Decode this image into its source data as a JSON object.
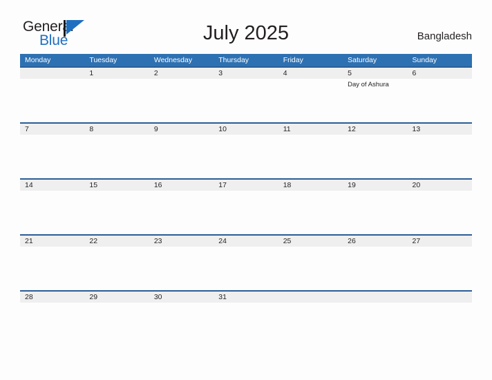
{
  "brand": {
    "name_part1": "General",
    "name_part2": "Blue",
    "flag_icon": "blue-flag-triangle-icon"
  },
  "header": {
    "title": "July 2025",
    "country": "Bangladesh"
  },
  "colors": {
    "header_blue": "#2e71b2",
    "row_rule_blue": "#2a5d96",
    "band_gray": "#efefef",
    "brand_blue": "#1f6fc0",
    "text": "#231f20",
    "page_background": "#fdfdfd"
  },
  "calendar": {
    "weekdays": [
      "Monday",
      "Tuesday",
      "Wednesday",
      "Thursday",
      "Friday",
      "Saturday",
      "Sunday"
    ],
    "weeks": [
      [
        {
          "date": "",
          "event": ""
        },
        {
          "date": "1",
          "event": ""
        },
        {
          "date": "2",
          "event": ""
        },
        {
          "date": "3",
          "event": ""
        },
        {
          "date": "4",
          "event": ""
        },
        {
          "date": "5",
          "event": "Day of Ashura"
        },
        {
          "date": "6",
          "event": ""
        }
      ],
      [
        {
          "date": "7",
          "event": ""
        },
        {
          "date": "8",
          "event": ""
        },
        {
          "date": "9",
          "event": ""
        },
        {
          "date": "10",
          "event": ""
        },
        {
          "date": "11",
          "event": ""
        },
        {
          "date": "12",
          "event": ""
        },
        {
          "date": "13",
          "event": ""
        }
      ],
      [
        {
          "date": "14",
          "event": ""
        },
        {
          "date": "15",
          "event": ""
        },
        {
          "date": "16",
          "event": ""
        },
        {
          "date": "17",
          "event": ""
        },
        {
          "date": "18",
          "event": ""
        },
        {
          "date": "19",
          "event": ""
        },
        {
          "date": "20",
          "event": ""
        }
      ],
      [
        {
          "date": "21",
          "event": ""
        },
        {
          "date": "22",
          "event": ""
        },
        {
          "date": "23",
          "event": ""
        },
        {
          "date": "24",
          "event": ""
        },
        {
          "date": "25",
          "event": ""
        },
        {
          "date": "26",
          "event": ""
        },
        {
          "date": "27",
          "event": ""
        }
      ],
      [
        {
          "date": "28",
          "event": ""
        },
        {
          "date": "29",
          "event": ""
        },
        {
          "date": "30",
          "event": ""
        },
        {
          "date": "31",
          "event": ""
        },
        {
          "date": "",
          "event": ""
        },
        {
          "date": "",
          "event": ""
        },
        {
          "date": "",
          "event": ""
        }
      ]
    ]
  }
}
